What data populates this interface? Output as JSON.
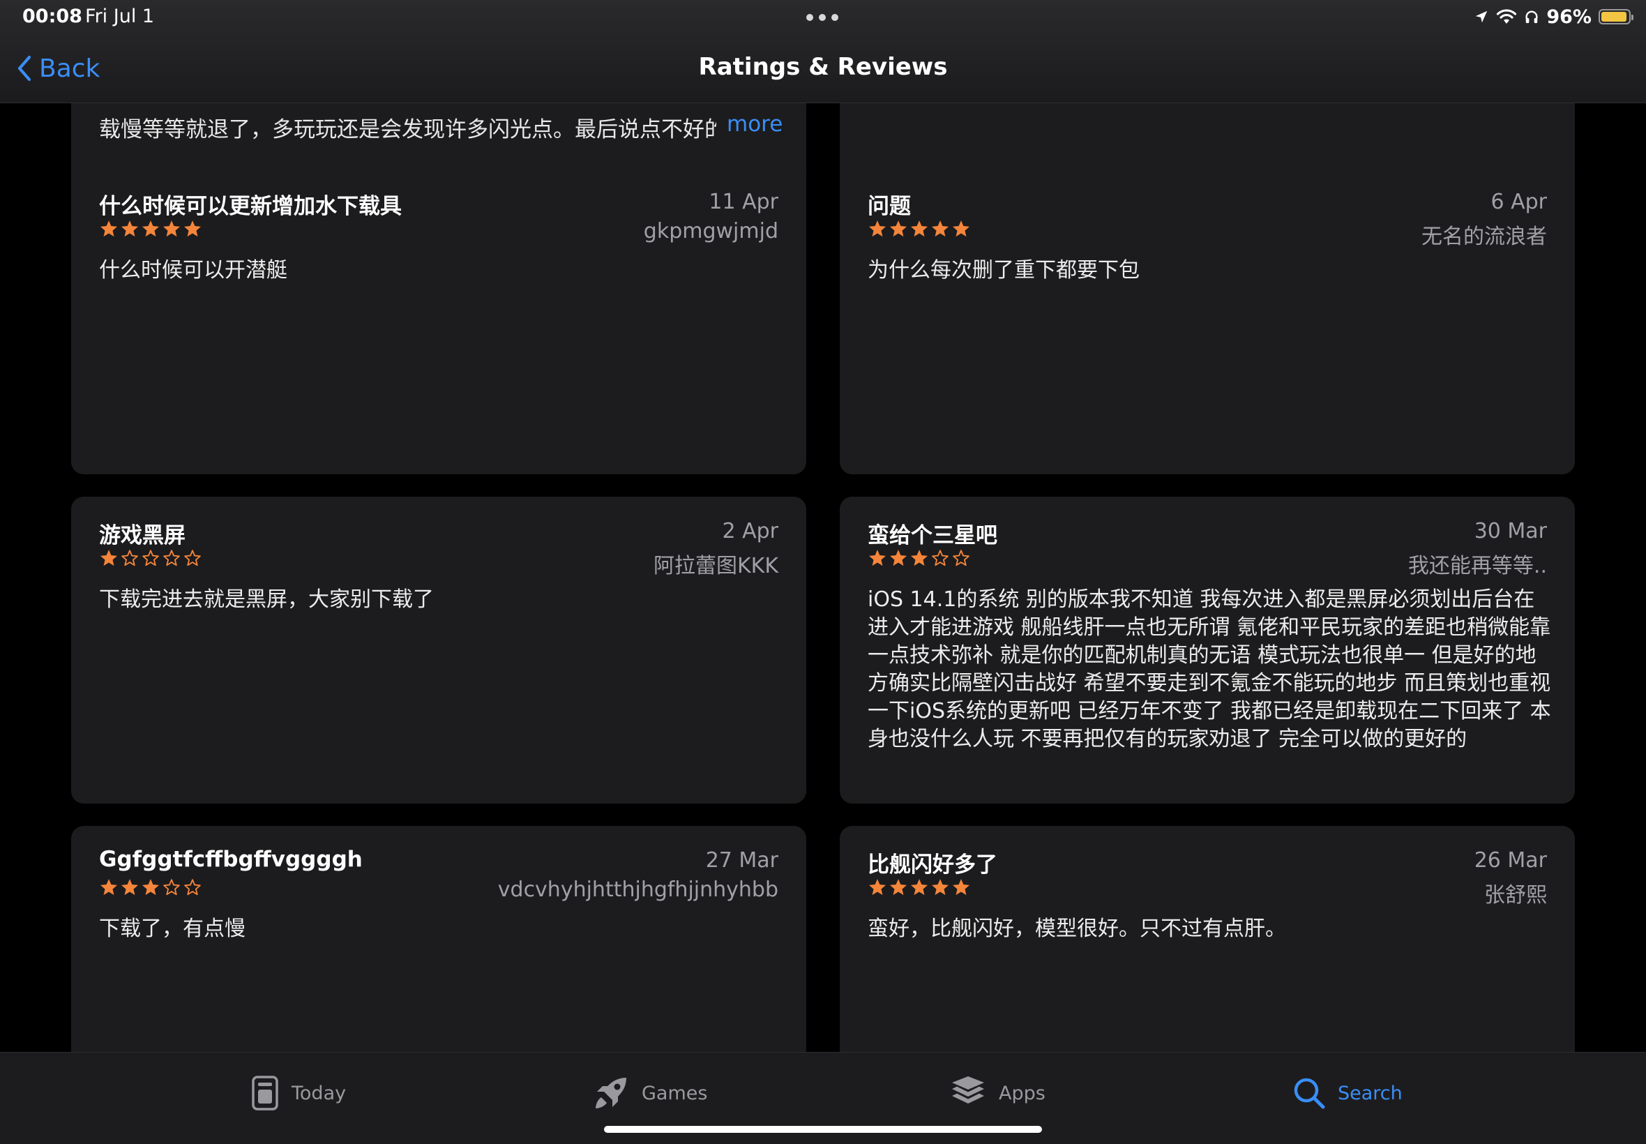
{
  "status_bar": {
    "time": "00:08",
    "date": "Fri Jul 1",
    "battery": "96%",
    "battery_level": 0.96
  },
  "nav": {
    "back_label": "Back",
    "title": "Ratings & Reviews"
  },
  "top_partial": {
    "text": "载慢等等就退了，多玩玩还是会发现许多闪光点。最后说点不好的",
    "more_label": "more"
  },
  "reviews": [
    {
      "title": "什么时候可以更新增加水下载具",
      "date": "11 Apr",
      "author": "gkpmgwjmjd",
      "rating": 5,
      "body": "什么时候可以开潜艇"
    },
    {
      "title": "问题",
      "date": "6 Apr",
      "author": "无名的流浪者",
      "rating": 5,
      "body": "为什么每次删了重下都要下包"
    },
    {
      "title": "游戏黑屏",
      "date": "2 Apr",
      "author": "阿拉蕾图KKK",
      "rating": 1,
      "body": "下载完进去就是黑屏，大家别下载了"
    },
    {
      "title": "蛮给个三星吧",
      "date": "30 Mar",
      "author": "我还能再等等..",
      "rating": 3,
      "body": "iOS 14.1的系统 别的版本我不知道 我每次进入都是黑屏必须划出后台在进入才能进游戏 舰船线肝一点也无所谓 氪佬和平民玩家的差距也稍微能靠一点技术弥补 就是你的匹配机制真的无语 模式玩法也很单一 但是好的地方确实比隔壁闪击战好 希望不要走到不氪金不能玩的地步 而且策划也重视一下iOS系统的更新吧 已经万年不变了 我都已经是卸载现在二下回来了 本身也没什么人玩 不要再把仅有的玩家劝退了 完全可以做的更好的"
    },
    {
      "title": "Ggfggtfcffbgffvggggh",
      "date": "27 Mar",
      "author": "vdcvhyhjhtthjhgfhjjnhyhbb",
      "rating": 3,
      "body": "下载了，有点慢"
    },
    {
      "title": "比舰闪好多了",
      "date": "26 Mar",
      "author": "张舒熙",
      "rating": 5,
      "body": "蛮好，比舰闪好，模型很好。只不过有点肝。"
    }
  ],
  "tabs": [
    {
      "label": "Today",
      "icon": "today-icon",
      "active": false
    },
    {
      "label": "Games",
      "icon": "rocket-icon",
      "active": false
    },
    {
      "label": "Apps",
      "icon": "layers-icon",
      "active": false
    },
    {
      "label": "Search",
      "icon": "search-icon",
      "active": true
    }
  ],
  "colors": {
    "accent": "#3a8ef6",
    "star": "#f5853a",
    "card": "#1c1c1e",
    "background": "#000000"
  }
}
